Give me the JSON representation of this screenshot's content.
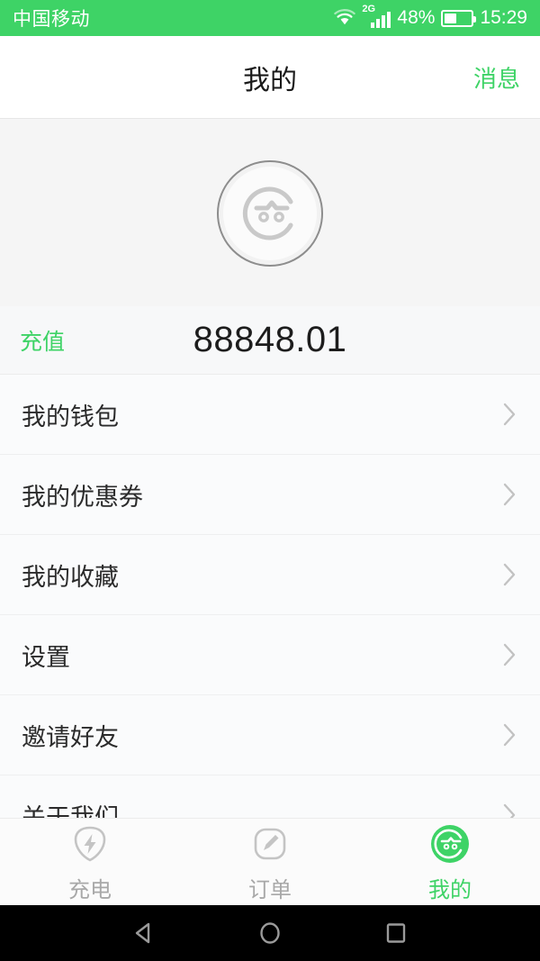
{
  "statusbar": {
    "carrier": "中国移动",
    "wifi_icon": "wifi-icon",
    "network_type": "2G",
    "signal_icon": "signal-bars-icon",
    "battery_percent": "48%",
    "battery_level": 45,
    "battery_icon": "battery-icon",
    "time": "15:29",
    "background": "#3ed366"
  },
  "header": {
    "title": "我的",
    "action_label": "消息",
    "action_color": "#3ed366"
  },
  "profile": {
    "avatar_icon": "user-face-avatar-icon"
  },
  "balance": {
    "topup_label": "充值",
    "amount": "88848.01",
    "topup_color": "#3ed366"
  },
  "menu": {
    "items": [
      {
        "label": "我的钱包",
        "chevron": "chevron-right-icon"
      },
      {
        "label": "我的优惠券",
        "chevron": "chevron-right-icon"
      },
      {
        "label": "我的收藏",
        "chevron": "chevron-right-icon"
      },
      {
        "label": "设置",
        "chevron": "chevron-right-icon"
      },
      {
        "label": "邀请好友",
        "chevron": "chevron-right-icon"
      },
      {
        "label": "关于我们",
        "chevron": "chevron-right-icon"
      }
    ]
  },
  "tabbar": {
    "tabs": [
      {
        "label": "充电",
        "icon": "lightning-bolt-shield-icon",
        "active": false
      },
      {
        "label": "订单",
        "icon": "pencil-square-icon",
        "active": false
      },
      {
        "label": "我的",
        "icon": "user-face-circle-icon",
        "active": true
      }
    ],
    "active_color": "#3ed366",
    "inactive_color": "#a8a8a8"
  },
  "navbar": {
    "back": "back-triangle-icon",
    "home": "home-circle-icon",
    "recents": "recents-square-icon"
  }
}
